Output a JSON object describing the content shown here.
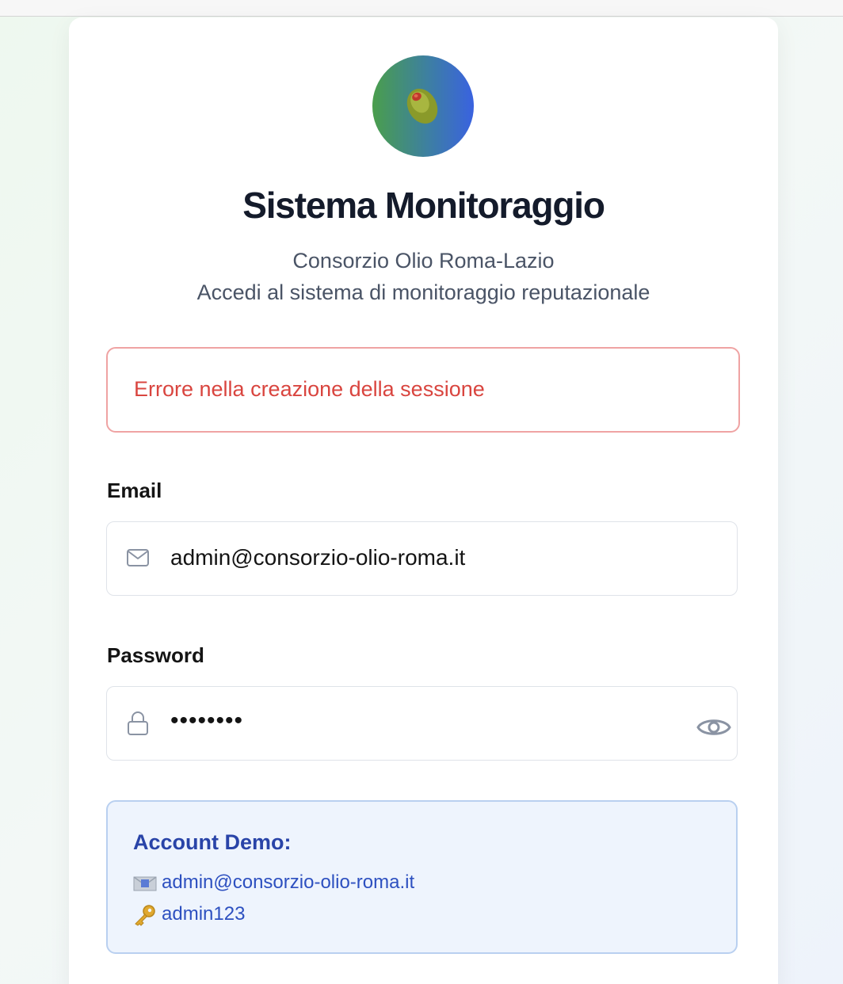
{
  "header": {
    "title": "Sistema Monitoraggio",
    "organization": "Consorzio Olio Roma-Lazio",
    "tagline": "Accedi al sistema di monitoraggio reputazionale"
  },
  "logo": {
    "icon": "olive-icon"
  },
  "error": {
    "message": "Errore nella creazione della sessione"
  },
  "form": {
    "email": {
      "label": "Email",
      "value": "admin@consorzio-olio-roma.it",
      "icon": "mail-icon"
    },
    "password": {
      "label": "Password",
      "value": "••••••••",
      "icon": "lock-icon",
      "toggle_icon": "eye-icon"
    }
  },
  "demo": {
    "title": "Account Demo:",
    "email": "admin@consorzio-olio-roma.it",
    "email_icon": "envelope-emoji-icon",
    "password": "admin123",
    "password_icon": "key-emoji-icon"
  },
  "colors": {
    "error_text": "#d9453f",
    "error_border": "#efa3a3",
    "demo_background": "#eef4fd",
    "demo_text": "#2d50c0",
    "title": "#141b2b"
  }
}
